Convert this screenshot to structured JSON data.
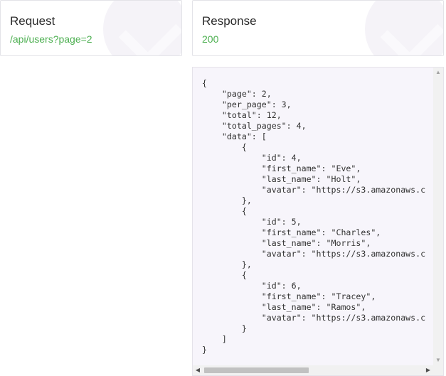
{
  "request": {
    "title": "Request",
    "endpoint": "/api/users?page=2"
  },
  "response": {
    "title": "Response",
    "status": "200",
    "body": "{\n    \"page\": 2,\n    \"per_page\": 3,\n    \"total\": 12,\n    \"total_pages\": 4,\n    \"data\": [\n        {\n            \"id\": 4,\n            \"first_name\": \"Eve\",\n            \"last_name\": \"Holt\",\n            \"avatar\": \"https://s3.amazonaws.c\n        },\n        {\n            \"id\": 5,\n            \"first_name\": \"Charles\",\n            \"last_name\": \"Morris\",\n            \"avatar\": \"https://s3.amazonaws.c\n        },\n        {\n            \"id\": 6,\n            \"first_name\": \"Tracey\",\n            \"last_name\": \"Ramos\",\n            \"avatar\": \"https://s3.amazonaws.c\n        }\n    ]\n}"
  },
  "icons": {
    "scroll_up": "▲",
    "scroll_down": "▼",
    "scroll_left": "◀",
    "scroll_right": "▶"
  },
  "colors": {
    "accent_green": "#4caf50",
    "code_background": "#f7f5fb"
  }
}
